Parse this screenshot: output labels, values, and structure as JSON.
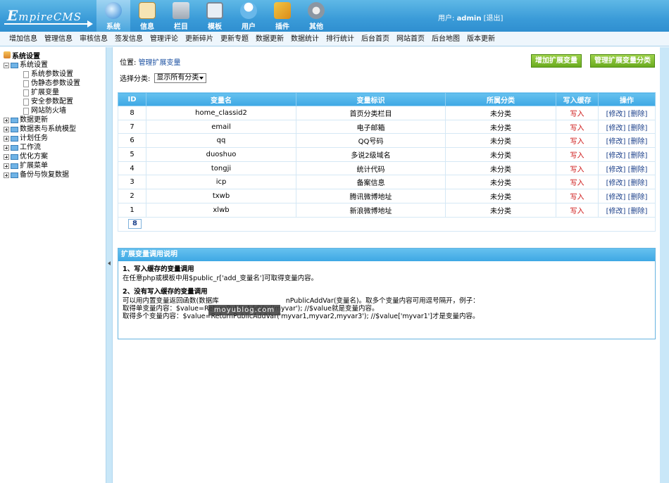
{
  "logo": {
    "first": "E",
    "rest": "mpireCMS"
  },
  "topnav": [
    {
      "label": "系统",
      "icon": "globe-icon"
    },
    {
      "label": "信息",
      "icon": "document-icon"
    },
    {
      "label": "栏目",
      "icon": "folder-icon"
    },
    {
      "label": "模板",
      "icon": "template-icon"
    },
    {
      "label": "用户",
      "icon": "user-icon"
    },
    {
      "label": "插件",
      "icon": "plugin-icon"
    },
    {
      "label": "其他",
      "icon": "gear-icon"
    }
  ],
  "user": {
    "prefix": "用户:",
    "name": "admin",
    "logout": "[退出]"
  },
  "menubar": [
    "增加信息",
    "管理信息",
    "审核信息",
    "签发信息",
    "管理评论",
    "更新碎片",
    "更新专题",
    "数据更新",
    "数据统计",
    "排行统计",
    "后台首页",
    "网站首页",
    "后台地图",
    "版本更新"
  ],
  "sidebar": {
    "root": "系统设置",
    "open": "系统设置",
    "children": [
      "系统参数设置",
      "伪静态参数设置",
      "扩展变量",
      "安全参数配置",
      "网站防火墙"
    ],
    "groups": [
      "数据更新",
      "数据表与系统模型",
      "计划任务",
      "工作流",
      "优化方案",
      "扩展菜单",
      "备份与恢复数据"
    ]
  },
  "location": {
    "prefix": "位置:",
    "link": "管理扩展变量"
  },
  "buttons": {
    "add": "增加扩展变量",
    "manage_class": "管理扩展变量分类"
  },
  "filter": {
    "label": "选择分类:",
    "selected": "显示所有分类"
  },
  "table": {
    "headers": [
      "ID",
      "变量名",
      "变量标识",
      "所属分类",
      "写入缓存",
      "操作"
    ],
    "rows": [
      {
        "id": "8",
        "name": "home_classid2",
        "title": "首页分类栏目",
        "class": "未分类",
        "cache": "写入",
        "edit": "[修改]",
        "del": "[删除]"
      },
      {
        "id": "7",
        "name": "email",
        "title": "电子邮箱",
        "class": "未分类",
        "cache": "写入",
        "edit": "[修改]",
        "del": "[删除]"
      },
      {
        "id": "6",
        "name": "qq",
        "title": "QQ号码",
        "class": "未分类",
        "cache": "写入",
        "edit": "[修改]",
        "del": "[删除]"
      },
      {
        "id": "5",
        "name": "duoshuo",
        "title": "多说2级域名",
        "class": "未分类",
        "cache": "写入",
        "edit": "[修改]",
        "del": "[删除]"
      },
      {
        "id": "4",
        "name": "tongji",
        "title": "统计代码",
        "class": "未分类",
        "cache": "写入",
        "edit": "[修改]",
        "del": "[删除]"
      },
      {
        "id": "3",
        "name": "icp",
        "title": "备案信息",
        "class": "未分类",
        "cache": "写入",
        "edit": "[修改]",
        "del": "[删除]"
      },
      {
        "id": "2",
        "name": "txwb",
        "title": "腾讯微博地址",
        "class": "未分类",
        "cache": "写入",
        "edit": "[修改]",
        "del": "[删除]"
      },
      {
        "id": "1",
        "name": "xlwb",
        "title": "新浪微博地址",
        "class": "未分类",
        "cache": "写入",
        "edit": "[修改]",
        "del": "[删除]"
      }
    ],
    "pager": "8"
  },
  "help": {
    "title": "扩展变量调用说明",
    "s1_title": "1、写入缓存的变量调用",
    "s1_text": "在任意php或模板中用$public_r['add_变量名']可取得变量内容。",
    "s2_title": "2、没有写入缓存的变量调用",
    "s2_line1": "可以用内置变量返回函数(数据库　　　　　　　　　　nPublicAddVar(变量名)。取多个变量内容可用逗号隔开，例子：",
    "s2_line2": "取得单变量内容：$value=ReturnPublicAddVar('myvar'); //$value就是变量内容。",
    "s2_line3": "取得多个变量内容：$value=ReturnPublicAddVar('myvar1,myvar2,myvar3'); //$value['myvar1']才是变量内容。"
  },
  "watermark": "moyublog.com"
}
